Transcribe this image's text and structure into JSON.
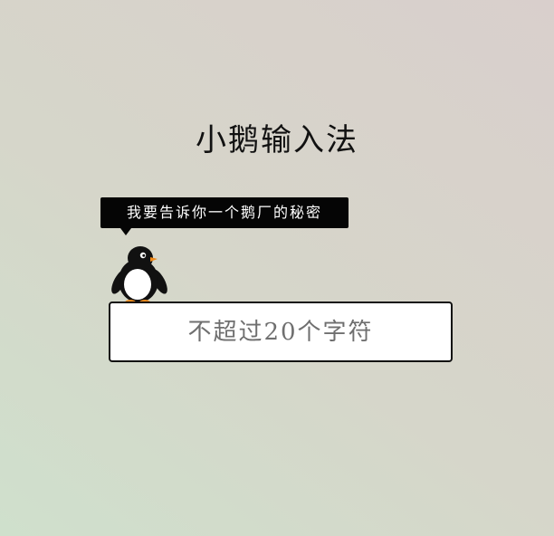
{
  "app": {
    "title": "小鹅输入法"
  },
  "mascot": {
    "tooltip_text": "我要告诉你一个鹅厂的秘密",
    "icon_name": "penguin-icon"
  },
  "input": {
    "value": "",
    "placeholder": "不超过20个字符"
  },
  "colors": {
    "background_start": "#cfe0cc",
    "background_end": "#d9cfcc",
    "tooltip_bg": "#050505",
    "input_border": "#111111"
  }
}
